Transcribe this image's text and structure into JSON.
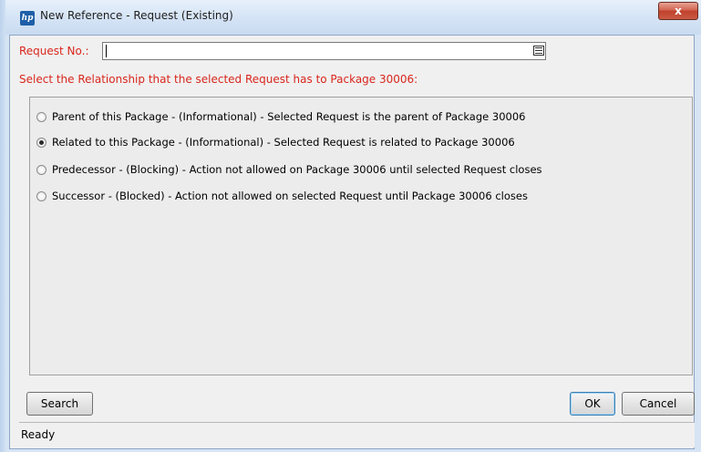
{
  "window": {
    "title": "New Reference - Request (Existing)",
    "close_label": "x",
    "icon_text": "hp"
  },
  "form": {
    "request_no_label": "Request No.:",
    "request_no_value": "",
    "relationship_prompt": "Select the Relationship that the selected Request has to Package 30006:"
  },
  "relationships": [
    {
      "label": "Parent of this Package - (Informational) - Selected Request is the parent of Package 30006",
      "checked": false
    },
    {
      "label": "Related to this Package - (Informational) - Selected Request is related to Package 30006",
      "checked": true
    },
    {
      "label": "Predecessor - (Blocking) - Action not allowed on Package 30006 until selected Request closes",
      "checked": false
    },
    {
      "label": "Successor - (Blocked) - Action not allowed on selected Request until Package 30006 closes",
      "checked": false
    }
  ],
  "buttons": {
    "search": "Search",
    "ok": "OK",
    "cancel": "Cancel"
  },
  "status": {
    "text": "Ready"
  },
  "colors": {
    "label_red": "#d9261c",
    "close_red": "#c0412d"
  },
  "icons": {
    "app": "hp-logo-icon",
    "close": "close-icon",
    "lookup": "list-lookup-icon"
  }
}
